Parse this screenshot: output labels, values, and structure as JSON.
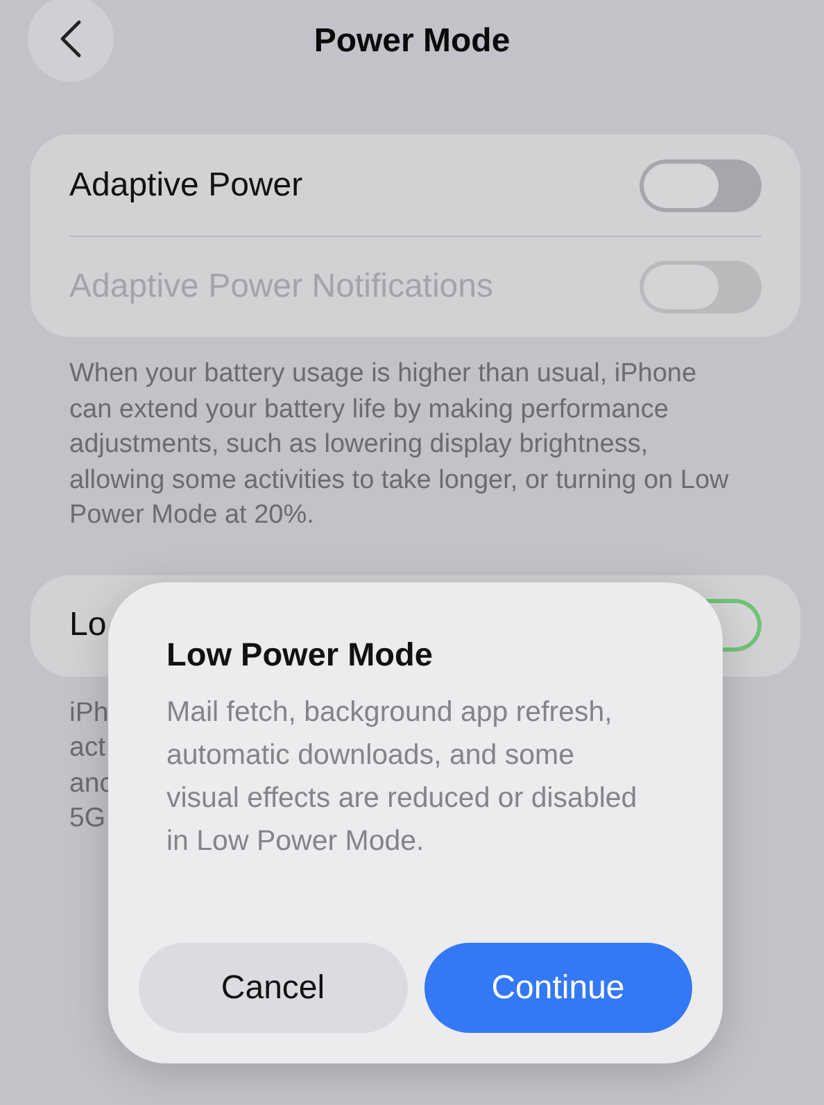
{
  "header": {
    "title": "Power Mode"
  },
  "group_1": {
    "rows": [
      {
        "label": "Adaptive Power",
        "on": false,
        "disabled": false
      },
      {
        "label": "Adaptive Power Notifications",
        "on": false,
        "disabled": true
      }
    ],
    "footer": "When your battery usage is higher than usual, iPhone can extend your battery life by making performance adjustments, such as lowering display brightness, allowing some activities to take longer, or turning on Low Power Mode at 20%."
  },
  "group_2": {
    "rows": [
      {
        "label": "Lo",
        "on": true,
        "disabled": false
      }
    ],
    "footer_lines": [
      "iPh",
      "act",
      "anc",
      "5G"
    ]
  },
  "dialog": {
    "title": "Low Power Mode",
    "message": "Mail fetch, background app refresh, automatic downloads, and some visual effects are reduced or disabled in Low Power Mode.",
    "buttons": [
      {
        "label": "Cancel",
        "kind": "secondary"
      },
      {
        "label": "Continue",
        "kind": "primary"
      }
    ]
  }
}
